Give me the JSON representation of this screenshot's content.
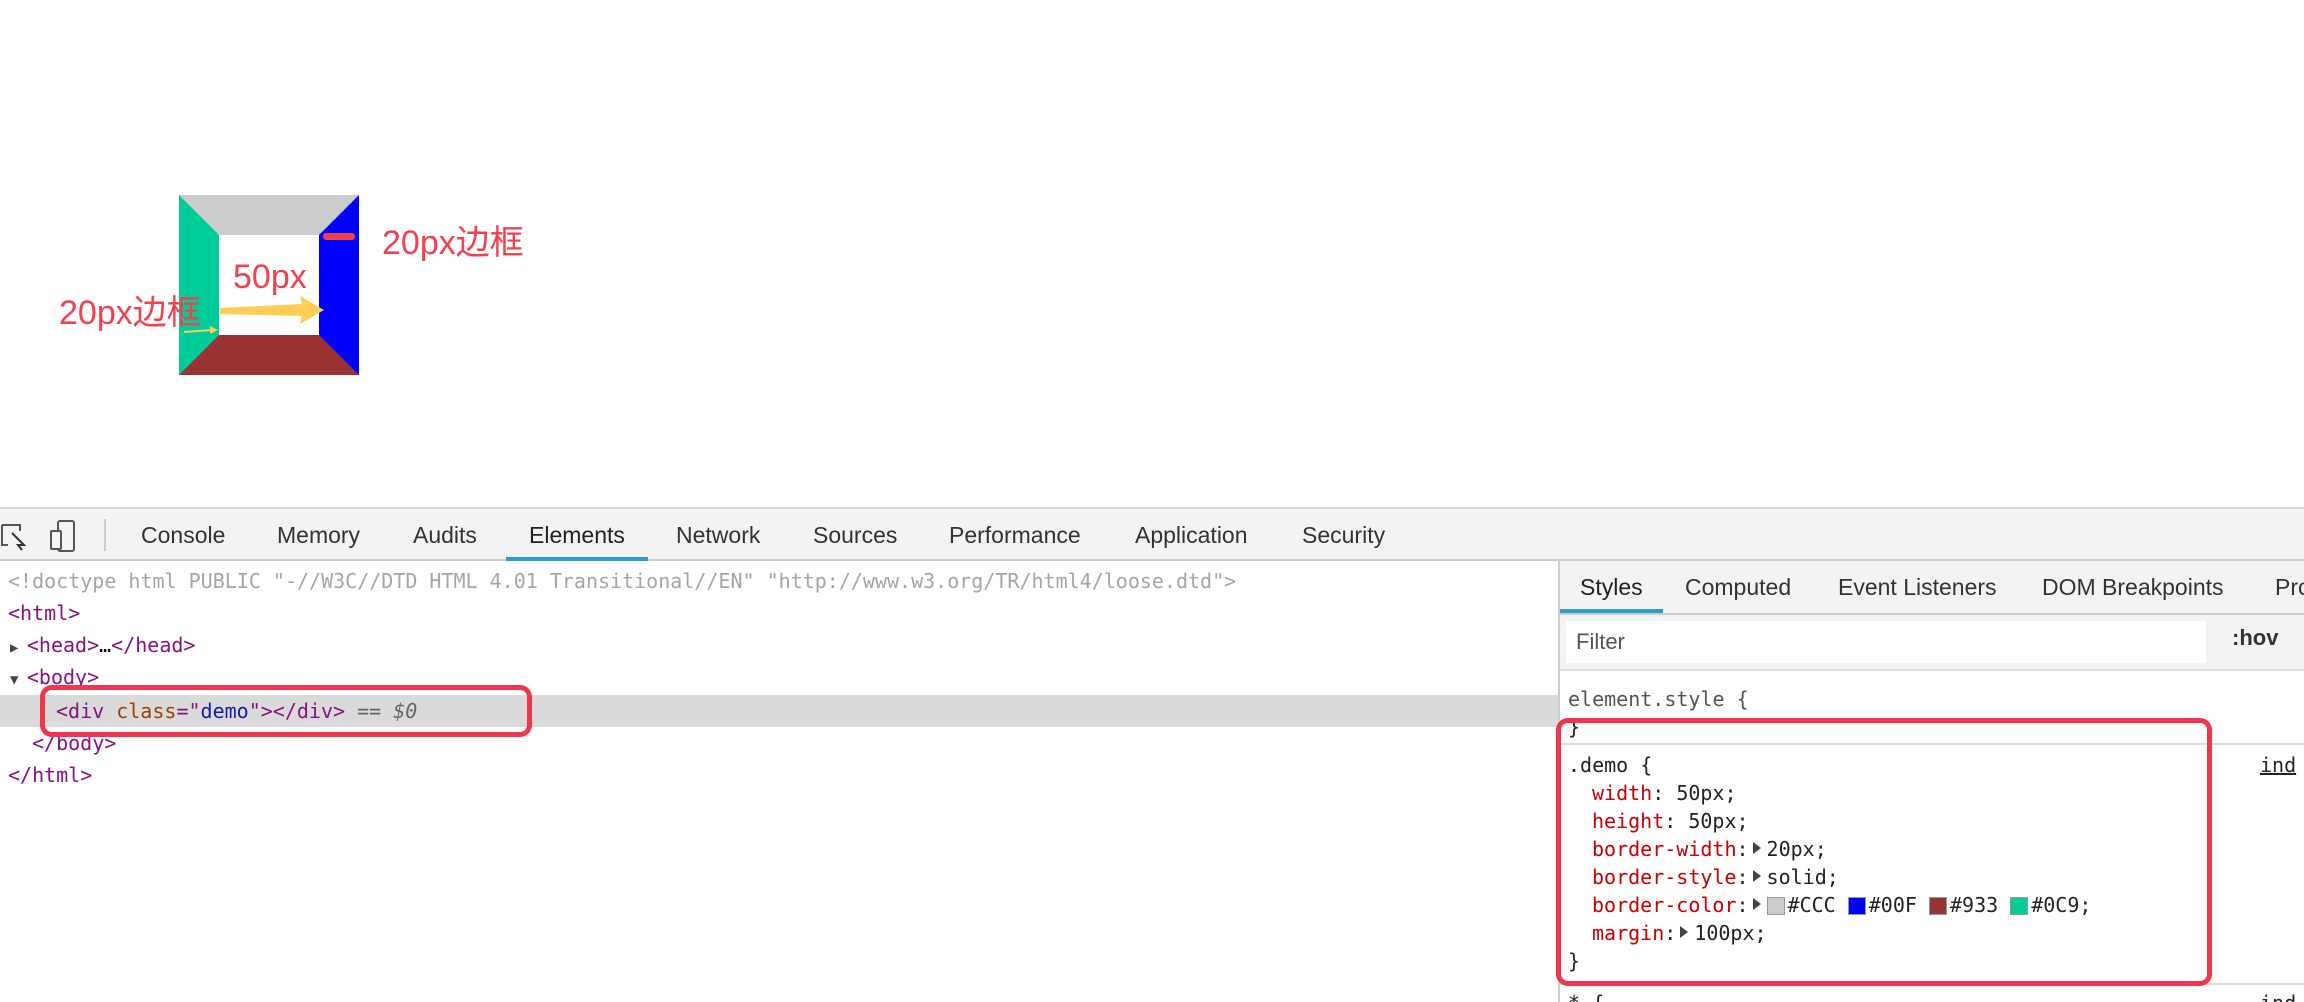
{
  "demo": {
    "border_colors": {
      "top": "#CCCCCC",
      "right": "#0000FF",
      "bottom": "#993333",
      "left": "#00CC99"
    },
    "annotation_right": "20px边框",
    "annotation_center": "50px",
    "annotation_left": "20px边框",
    "annotation_color": "#f2404f",
    "arrow_color": "#ffcc55"
  },
  "toolbar": {
    "icons": [
      "inspect-icon",
      "device-toggle-icon"
    ],
    "tabs": [
      {
        "label": "Console"
      },
      {
        "label": "Memory"
      },
      {
        "label": "Audits"
      },
      {
        "label": "Elements",
        "active": true
      },
      {
        "label": "Network"
      },
      {
        "label": "Sources"
      },
      {
        "label": "Performance"
      },
      {
        "label": "Application"
      },
      {
        "label": "Security"
      }
    ]
  },
  "dom": {
    "doctype": "<!doctype html PUBLIC \"-//W3C//DTD HTML 4.01 Transitional//EN\" \"http://www.w3.org/TR/html4/loose.dtd\">",
    "html_open": "<html>",
    "head_open": "<head>",
    "ellipsis": "…",
    "head_close": "</head>",
    "body_open": "<body>",
    "div_open": "<div",
    "attr_name": "class",
    "attr_eq": "=\"",
    "attr_value": "demo",
    "attr_end": "\">",
    "div_close": "</div>",
    "selected_marker": "== $0",
    "body_close": "</body>",
    "html_close": "</html>"
  },
  "styles": {
    "tabs": [
      {
        "label": "Styles",
        "active": true
      },
      {
        "label": "Computed"
      },
      {
        "label": "Event Listeners"
      },
      {
        "label": "DOM Breakpoints"
      },
      {
        "label": "Pro"
      }
    ],
    "filter_placeholder": "Filter",
    "hov": ":hov",
    "element_style_open": "element.style {",
    "close_brace": "}",
    "rule_selector": ".demo {",
    "source_link": "ind",
    "declarations": [
      {
        "prop": "width",
        "value": "50px;"
      },
      {
        "prop": "height",
        "value": "50px;"
      },
      {
        "prop": "border-width",
        "value": "20px;",
        "expandable": true
      },
      {
        "prop": "border-style",
        "value": "solid;",
        "expandable": true
      },
      {
        "prop": "margin",
        "value": "100px;",
        "expandable": true
      }
    ],
    "border_color": {
      "prop": "border-color",
      "swatches": [
        {
          "color": "#CCCCCC",
          "text": "#CCC"
        },
        {
          "color": "#0000FF",
          "text": "#00F"
        },
        {
          "color": "#993333",
          "text": "#933"
        },
        {
          "color": "#00CC99",
          "text": "#0C9;"
        }
      ]
    },
    "next_rule": "* {",
    "next_source": "ind"
  }
}
